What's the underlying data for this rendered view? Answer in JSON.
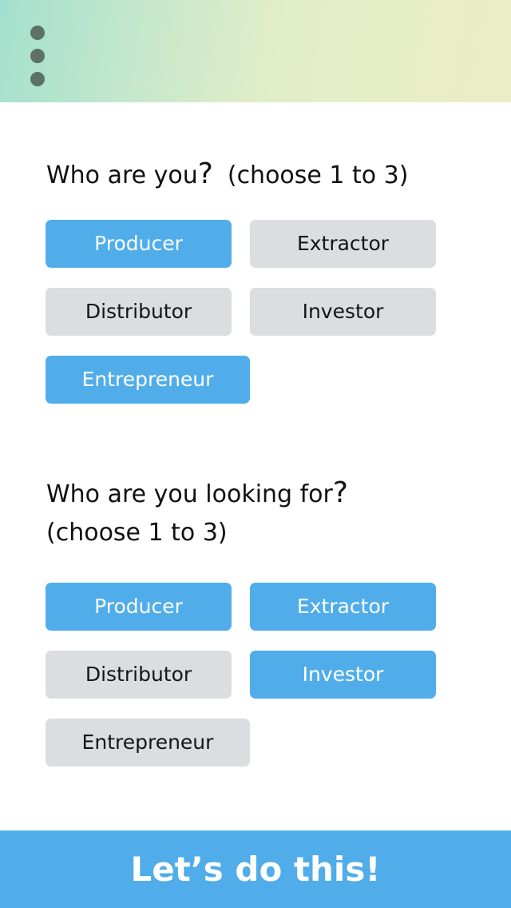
{
  "header": {
    "menu_icon": "vertical-ellipsis-icon",
    "gradient_colors": [
      "#a3e0cf",
      "#ebedc6"
    ]
  },
  "colors": {
    "selected": "#50adea",
    "unselected": "#dcdde0",
    "selected_text": "#ffffff",
    "unselected_text": "#151515"
  },
  "section_self": {
    "question": "Who are you",
    "qmark": "?",
    "hint": "(choose 1 to 3)",
    "options": [
      {
        "label": "Producer",
        "selected": true
      },
      {
        "label": "Extractor",
        "selected": false
      },
      {
        "label": "Distributor",
        "selected": false
      },
      {
        "label": "Investor",
        "selected": false
      },
      {
        "label": "Entrepreneur",
        "selected": true
      }
    ]
  },
  "section_target": {
    "question": "Who are you looking for",
    "qmark": "?",
    "hint": "(choose 1 to 3)",
    "options": [
      {
        "label": "Producer",
        "selected": true
      },
      {
        "label": "Extractor",
        "selected": true
      },
      {
        "label": "Distributor",
        "selected": false
      },
      {
        "label": "Investor",
        "selected": true
      },
      {
        "label": "Entrepreneur",
        "selected": false
      }
    ]
  },
  "cta": {
    "label": "Let’s do this!"
  }
}
